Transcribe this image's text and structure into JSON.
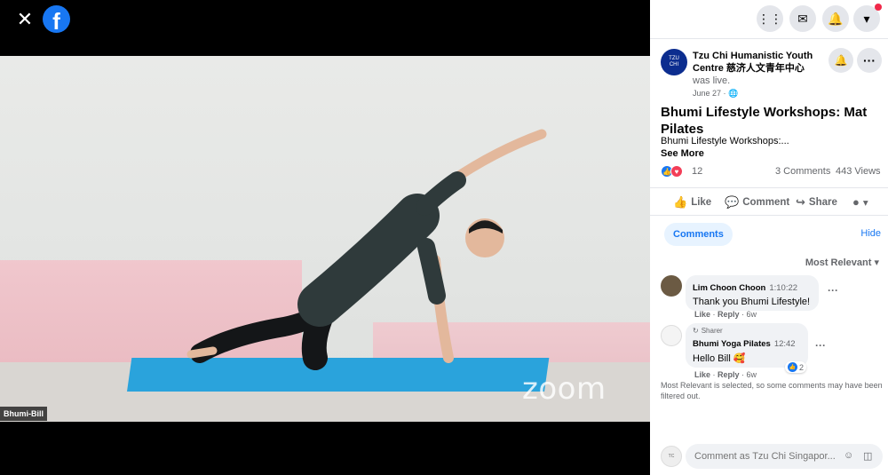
{
  "viewer": {
    "participant_name": "Bhumi-Bill",
    "watermark": "zoom"
  },
  "post": {
    "page_name": "Tzu Chi Humanistic Youth Centre 慈济人文青年中心",
    "status": "was live.",
    "date": "June 27 · ",
    "title": "Bhumi Lifestyle Workshops: Mat Pilates",
    "description": "Bhumi Lifestyle Workshops:...",
    "see_more": "See More",
    "reaction_count": "12",
    "comments_count": "3 Comments",
    "views_count": "443 Views"
  },
  "actions": {
    "like": "Like",
    "comment": "Comment",
    "share": "Share"
  },
  "comments_section": {
    "tab_label": "Comments",
    "hide_label": "Hide",
    "sort_label": "Most Relevant",
    "filter_note": "Most Relevant is selected, so some comments may have been filtered out.",
    "items": [
      {
        "author": "Lim Choon Choon",
        "time": "1:10:22",
        "text": "Thank you Bhumi Lifestyle!",
        "like": "Like",
        "reply": "Reply",
        "age": "6w"
      },
      {
        "sharer_label": "Sharer",
        "author": "Bhumi Yoga Pilates",
        "time": "12:42",
        "text": "Hello Bill 🥰",
        "like": "Like",
        "reply": "Reply",
        "age": "6w",
        "reaction_count": "2"
      }
    ]
  },
  "composer": {
    "placeholder": "Comment as Tzu Chi Singapor..."
  },
  "colors": {
    "brand": "#1877f2",
    "mat": "#2aa3dc",
    "notification": "#f02849"
  }
}
